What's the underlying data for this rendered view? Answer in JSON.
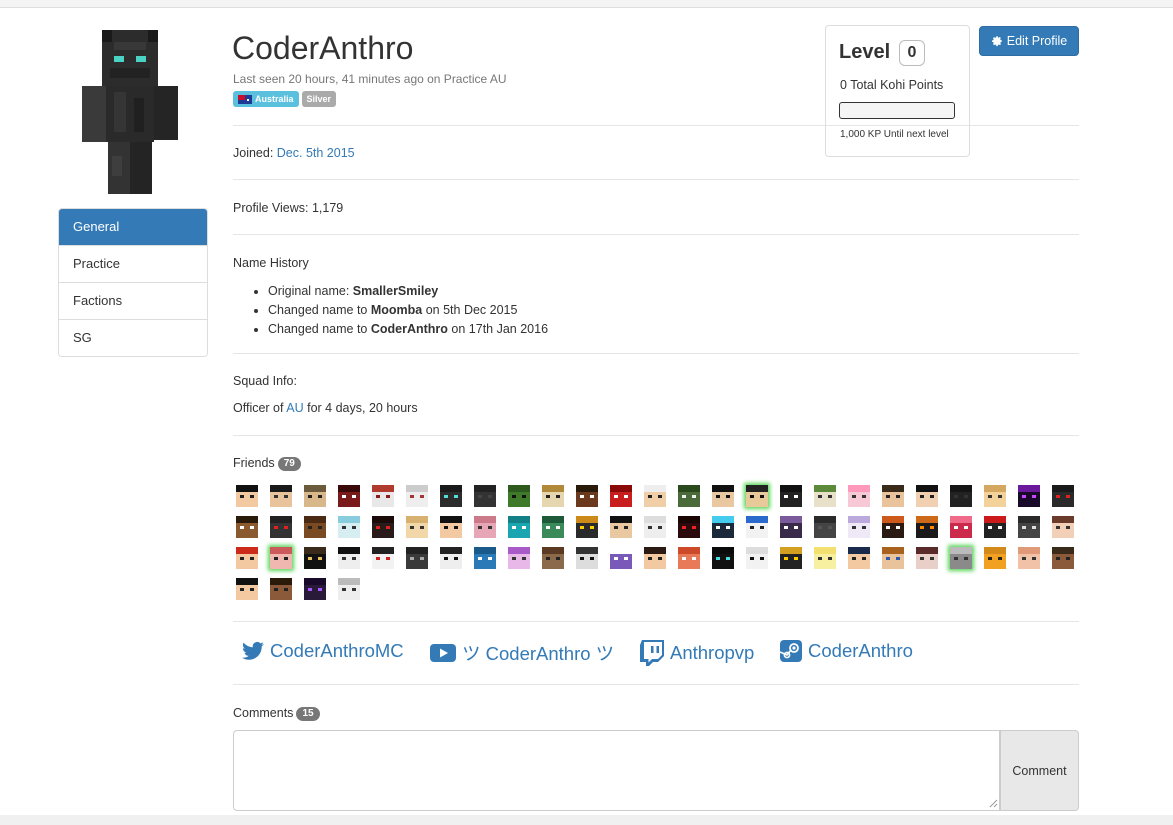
{
  "profile": {
    "username": "CoderAnthro",
    "last_seen": "Last seen 20 hours, 41 minutes ago on Practice AU",
    "badges": [
      "Australia",
      "Silver"
    ],
    "joined_label": "Joined: ",
    "joined_date": "Dec. 5th 2015",
    "profile_views": "Profile Views: 1,179"
  },
  "sidebar": {
    "items": [
      {
        "label": "General",
        "active": true
      },
      {
        "label": "Practice",
        "active": false
      },
      {
        "label": "Factions",
        "active": false
      },
      {
        "label": "SG",
        "active": false
      }
    ]
  },
  "level": {
    "title": "Level",
    "value": "0",
    "points": "0 Total Kohi Points",
    "progress_fraction": 0,
    "next": "1,000 KP Until next level"
  },
  "edit_profile": {
    "label": "Edit Profile"
  },
  "name_history": {
    "heading": "Name History",
    "entries": [
      {
        "prefix": "Original name: ",
        "name": "SmallerSmiley",
        "suffix": ""
      },
      {
        "prefix": "Changed name to ",
        "name": "Moomba",
        "suffix": " on 5th Dec 2015"
      },
      {
        "prefix": "Changed name to ",
        "name": "CoderAnthro",
        "suffix": " on 17th Jan 2016"
      }
    ]
  },
  "squad": {
    "heading": "Squad Info:",
    "prefix": "Officer of ",
    "squad_name": "AU",
    "suffix": " for 4 days, 20 hours"
  },
  "friends": {
    "heading": "Friends",
    "count": "79",
    "faces": [
      {
        "skin": "#f2c9a0",
        "hair": "#111111",
        "eye": "#222222",
        "online": false
      },
      {
        "skin": "#e9c39b",
        "hair": "#1a1a1a",
        "eye": "#333333",
        "online": false
      },
      {
        "skin": "#d8b88a",
        "hair": "#6b5a3c",
        "eye": "#222222",
        "online": false
      },
      {
        "skin": "#7a1a1a",
        "hair": "#3a0a0a",
        "eye": "#ffffff",
        "online": false
      },
      {
        "skin": "#e8e8e8",
        "hair": "#b03a2e",
        "eye": "#8a1a1a",
        "online": false
      },
      {
        "skin": "#eeeeee",
        "hair": "#cccccc",
        "eye": "#aa3333",
        "online": false
      },
      {
        "skin": "#2b2b2b",
        "hair": "#1a1a1a",
        "eye": "#55dddd",
        "online": false
      },
      {
        "skin": "#333333",
        "hair": "#222222",
        "eye": "#444444",
        "online": false
      },
      {
        "skin": "#3f7a2a",
        "hair": "#2e5a1e",
        "eye": "#111111",
        "online": false
      },
      {
        "skin": "#e6d6b0",
        "hair": "#b08a3a",
        "eye": "#222222",
        "online": false
      },
      {
        "skin": "#6b3a1e",
        "hair": "#2a1a0a",
        "eye": "#ffffff",
        "online": false
      },
      {
        "skin": "#c81e1e",
        "hair": "#8a0a0a",
        "eye": "#ffffff",
        "online": false
      },
      {
        "skin": "#f0cfa8",
        "hair": "#eeeeee",
        "eye": "#222222",
        "online": false
      },
      {
        "skin": "#4a6a3a",
        "hair": "#2a4a1e",
        "eye": "#eeeeee",
        "online": false
      },
      {
        "skin": "#e9c7a0",
        "hair": "#111111",
        "eye": "#111111",
        "online": false
      },
      {
        "skin": "#e8c99a",
        "hair": "#222222",
        "eye": "#111111",
        "online": true
      },
      {
        "skin": "#222222",
        "hair": "#111111",
        "eye": "#ffffff",
        "online": false
      },
      {
        "skin": "#e8e0c8",
        "hair": "#5a8a3a",
        "eye": "#333333",
        "online": false
      },
      {
        "skin": "#f7c9d6",
        "hair": "#ff99bb",
        "eye": "#333333",
        "online": false
      },
      {
        "skin": "#e9c39b",
        "hair": "#3a2a1a",
        "eye": "#222222",
        "online": false
      },
      {
        "skin": "#f0d0b0",
        "hair": "#111111",
        "eye": "#222222",
        "online": false
      },
      {
        "skin": "#222222",
        "hair": "#151515",
        "eye": "#333333",
        "online": false
      },
      {
        "skin": "#f2d29a",
        "hair": "#d4a860",
        "eye": "#333333",
        "online": false
      },
      {
        "skin": "#1a0a2a",
        "hair": "#6a1a9a",
        "eye": "#cc44ff",
        "online": false
      },
      {
        "skin": "#2a2a2a",
        "hair": "#1a1a1a",
        "eye": "#dd2222",
        "online": false
      },
      {
        "skin": "#8a5a2e",
        "hair": "#2a1a0a",
        "eye": "#ffffff",
        "online": false
      },
      {
        "skin": "#333333",
        "hair": "#222222",
        "eye": "#dd2222",
        "online": false
      },
      {
        "skin": "#7a4a22",
        "hair": "#4a2a12",
        "eye": "#222222",
        "online": false
      },
      {
        "skin": "#d6eef2",
        "hair": "#88ccdd",
        "eye": "#333333",
        "online": false
      },
      {
        "skin": "#2a1a1a",
        "hair": "#1a0a0a",
        "eye": "#dd2222",
        "online": false
      },
      {
        "skin": "#f2d7a8",
        "hair": "#d8b070",
        "eye": "#333333",
        "online": false
      },
      {
        "skin": "#f2c9a0",
        "hair": "#111111",
        "eye": "#111111",
        "online": false
      },
      {
        "skin": "#e7a6b6",
        "hair": "#cc7a8a",
        "eye": "#333333",
        "online": false
      },
      {
        "skin": "#1aa6b0",
        "hair": "#138088",
        "eye": "#ffffff",
        "online": false
      },
      {
        "skin": "#3a8a5a",
        "hair": "#1e5a3a",
        "eye": "#ffffff",
        "online": false
      },
      {
        "skin": "#2a2a2a",
        "hair": "#cc8a1a",
        "eye": "#ffcc00",
        "online": false
      },
      {
        "skin": "#e9c7a0",
        "hair": "#111111",
        "eye": "#222222",
        "online": false
      },
      {
        "skin": "#eeeeee",
        "hair": "#dddddd",
        "eye": "#333333",
        "online": false
      },
      {
        "skin": "#2a0a0a",
        "hair": "#1a0505",
        "eye": "#ee2222",
        "online": false
      },
      {
        "skin": "#1a2a3a",
        "hair": "#44ccee",
        "eye": "#ffffff",
        "online": false
      },
      {
        "skin": "#f2f2f2",
        "hair": "#2a6acc",
        "eye": "#222222",
        "online": false
      },
      {
        "skin": "#3a2a4a",
        "hair": "#7a5a9a",
        "eye": "#ffffff",
        "online": false
      },
      {
        "skin": "#444444",
        "hair": "#2a2a2a",
        "eye": "#555555",
        "online": false
      },
      {
        "skin": "#eee8f7",
        "hair": "#bba8dd",
        "eye": "#333333",
        "online": false
      },
      {
        "skin": "#2a1a12",
        "hair": "#cc5a1a",
        "eye": "#ffffff",
        "online": false
      },
      {
        "skin": "#1a1a1a",
        "hair": "#cc6a1a",
        "eye": "#ff8800",
        "online": false
      },
      {
        "skin": "#cc2a4a",
        "hair": "#f06a8a",
        "eye": "#ffffff",
        "online": false
      },
      {
        "skin": "#222222",
        "hair": "#cc1a1a",
        "eye": "#ffffff",
        "online": false
      },
      {
        "skin": "#444444",
        "hair": "#2a2a2a",
        "eye": "#dddddd",
        "online": false
      },
      {
        "skin": "#f2d0b8",
        "hair": "#6a3a2a",
        "eye": "#333333",
        "online": false
      },
      {
        "skin": "#f2c9a0",
        "hair": "#cc2a1a",
        "eye": "#222222",
        "online": false
      },
      {
        "skin": "#f0b7b0",
        "hair": "#cc5a5a",
        "eye": "#222222",
        "online": true
      },
      {
        "skin": "#111111",
        "hair": "#3a2a1a",
        "eye": "#e8c060",
        "online": false
      },
      {
        "skin": "#eeeeee",
        "hair": "#111111",
        "eye": "#333333",
        "online": false
      },
      {
        "skin": "#f2f2f2",
        "hair": "#222222",
        "eye": "#cc2222",
        "online": false
      },
      {
        "skin": "#3a3a3a",
        "hair": "#222222",
        "eye": "#aaaaaa",
        "online": false
      },
      {
        "skin": "#eeeeee",
        "hair": "#222222",
        "eye": "#111111",
        "online": false
      },
      {
        "skin": "#2a7ab8",
        "hair": "#1a5a8a",
        "eye": "#ffffff",
        "online": false
      },
      {
        "skin": "#e8b8e8",
        "hair": "#a85ac8",
        "eye": "#333333",
        "online": false
      },
      {
        "skin": "#8a6a4a",
        "hair": "#5a3a22",
        "eye": "#222222",
        "online": false
      },
      {
        "skin": "#dddddd",
        "hair": "#333333",
        "eye": "#111111",
        "online": false
      },
      {
        "skin": "#7a5ab8",
        "hair": "#ffffff",
        "eye": "#ffffff",
        "online": false
      },
      {
        "skin": "#f2c9a0",
        "hair": "#2a1a12",
        "eye": "#222222",
        "online": false
      },
      {
        "skin": "#e87a5a",
        "hair": "#cc4a2a",
        "eye": "#ffffff",
        "online": false
      },
      {
        "skin": "#111111",
        "hair": "#0a0a0a",
        "eye": "#4ae0e0",
        "online": false
      },
      {
        "skin": "#f2f2f2",
        "hair": "#dddddd",
        "eye": "#111111",
        "online": false
      },
      {
        "skin": "#222222",
        "hair": "#d4a020",
        "eye": "#ffcc00",
        "online": false
      },
      {
        "skin": "#f7f0a0",
        "hair": "#f2e070",
        "eye": "#333333",
        "online": false
      },
      {
        "skin": "#f2c9a0",
        "hair": "#1a2a4a",
        "eye": "#222222",
        "online": false
      },
      {
        "skin": "#e9c39b",
        "hair": "#a8621e",
        "eye": "#2a5aa8",
        "online": false
      },
      {
        "skin": "#e8d0c8",
        "hair": "#5a2a2a",
        "eye": "#333333",
        "online": false
      },
      {
        "skin": "#8a8a8a",
        "hair": "#bbbbbb",
        "eye": "#333333",
        "online": true
      },
      {
        "skin": "#f2a020",
        "hair": "#d48a1a",
        "eye": "#222222",
        "online": false
      },
      {
        "skin": "#f2c2a8",
        "hair": "#e09a7a",
        "eye": "#333333",
        "online": false
      },
      {
        "skin": "#8a5a3a",
        "hair": "#3a2a1a",
        "eye": "#222222",
        "online": false
      },
      {
        "skin": "#f2c9a0",
        "hair": "#111111",
        "eye": "#222222",
        "online": false
      },
      {
        "skin": "#8a5a3a",
        "hair": "#2a1a0a",
        "eye": "#222222",
        "online": false
      },
      {
        "skin": "#2a1a3a",
        "hair": "#1a0a2a",
        "eye": "#aa55ff",
        "online": false
      },
      {
        "skin": "#eeeeee",
        "hair": "#bbbbbb",
        "eye": "#333333",
        "online": false
      }
    ]
  },
  "social": [
    {
      "icon": "twitter-icon",
      "label": "CoderAnthroMC"
    },
    {
      "icon": "youtube-icon",
      "label": "ツ CoderAnthro ツ"
    },
    {
      "icon": "twitch-icon",
      "label": "Anthropvp"
    },
    {
      "icon": "steam-icon",
      "label": "CoderAnthro"
    }
  ],
  "comments": {
    "heading": "Comments",
    "count": "15",
    "placeholder": "",
    "button_label": "Comment"
  },
  "colors": {
    "primary": "#337ab7",
    "online_glow": "#5cd65c",
    "badge_grey": "#777777"
  }
}
